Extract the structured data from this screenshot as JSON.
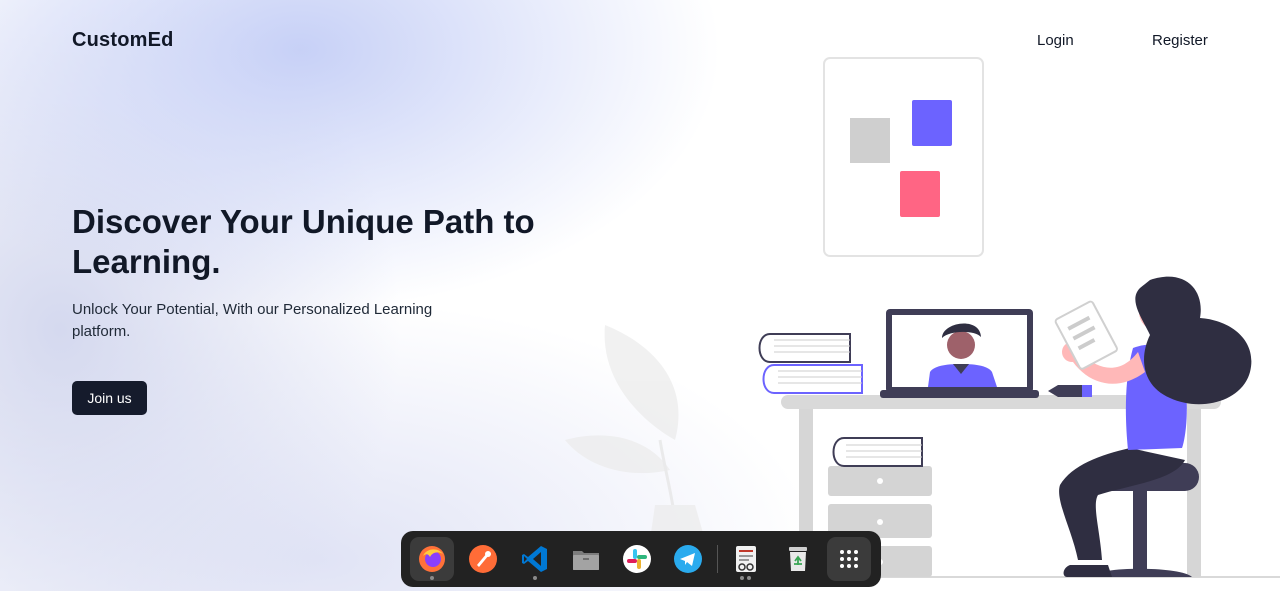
{
  "brand": {
    "name": "CustomEd"
  },
  "nav": {
    "login_label": "Login",
    "register_label": "Register"
  },
  "hero": {
    "headline": "Discover Your Unique Path to Learning.",
    "subtext": "Unlock Your Potential, With our Personalized Learning platform.",
    "cta_label": "Join us"
  },
  "colors": {
    "text": "#111827",
    "button_bg": "#151b2c",
    "accent_purple": "#6c63ff",
    "accent_pink": "#ff6584",
    "dock_bg": "#222222"
  },
  "dock": {
    "items": [
      {
        "icon": "firefox-icon",
        "running": true,
        "active": true
      },
      {
        "icon": "postman-icon",
        "running": false
      },
      {
        "icon": "vscode-icon",
        "running": true
      },
      {
        "icon": "files-icon",
        "running": false
      },
      {
        "icon": "slack-icon",
        "running": false
      },
      {
        "icon": "telegram-icon",
        "running": false
      },
      {
        "icon": "document-viewer-icon",
        "running": true
      },
      {
        "icon": "trash-icon",
        "running": false
      },
      {
        "icon": "app-grid-icon",
        "running": false
      }
    ]
  }
}
